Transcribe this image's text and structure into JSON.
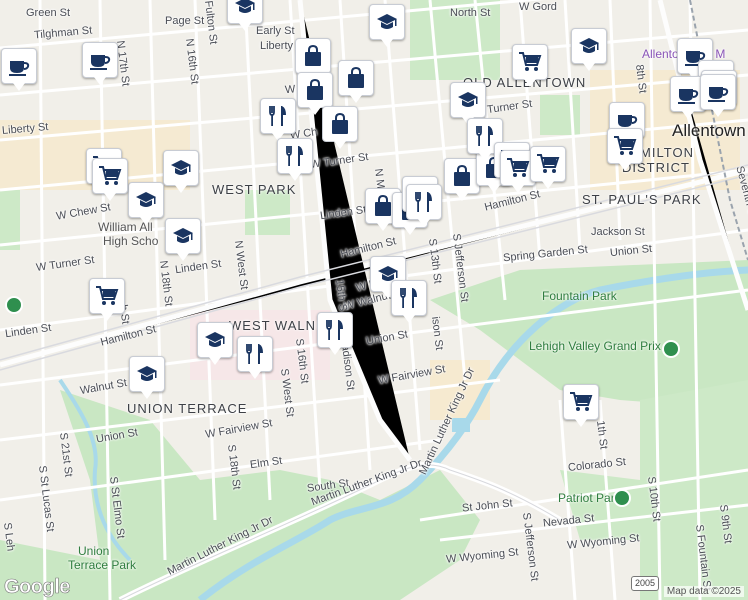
{
  "map": {
    "city": "Allentown",
    "districts": [
      "OLD ALLENTOWN",
      "WEST PARK",
      "ST. PAUL'S PARK",
      "WEST WALNUT",
      "UNION TERRACE",
      "HAMILTON DISTRICT"
    ],
    "district_hamilton_top": "HAMILTON",
    "district_hamilton_bottom": "DISTRICT",
    "pois": {
      "lehigh_valley_grand_prix": "Lehigh Valley Grand Prix",
      "fountain_park": "Fountain Park",
      "patriot_park": "Patriot Park",
      "union_terrace_park_1": "Union",
      "union_terrace_park_2": "Terrace Park",
      "william_allen_1": "William All",
      "william_allen_2": "High Scho",
      "allentown_art_museum": "Allentown Art M"
    },
    "streets": {
      "green": "Green St",
      "tilghman": "Tilghman St",
      "n17th": "N 17th St",
      "page": "Page St",
      "n16th": "N 16th St",
      "fulton_top": "Fulton St",
      "early": "Early St",
      "liberty_top": "Liberty St",
      "liberty_left": "Liberty St",
      "w_gordon": "W Go",
      "north": "North St",
      "w_gordon_right": "W Gord",
      "w_turner_mid": "W Turner St",
      "w_turner_left": "W Turner St",
      "turner_right": "Turner St",
      "w_chew": "W Chew St",
      "w_ch": "W Ch",
      "linden_mid": "Linden St",
      "linden_left": "Linden St",
      "linden_far": "Linden St",
      "n18th": "N 18th St",
      "n_west": "N West St",
      "n_m": "N M",
      "hamilton_main": "Hamilton St",
      "hamilton_left": "Hamilton St",
      "hamilton_right": "Hamilton St",
      "w_ma": "W Ma",
      "walnut_w": "W Walnut",
      "walnut_left": "Walnut St",
      "s13th": "S 13th St",
      "s_jefferson": "S Jefferson St",
      "jackson": "Jackson St",
      "spring_garden": "Spring Garden St",
      "union_right": "Union St",
      "union_mid": "Union St",
      "union_left": "Union St",
      "th15": "15th S",
      "h18th": "h St",
      "s16th": "S 16th St",
      "s_west": "S West St",
      "madison": "adison St",
      "ison": "ison St",
      "w_fairview_mid": "W Fairview St",
      "w_fairview_left": "W Fairview St",
      "s21st": "S 21st St",
      "s_st_lucas": "S St Lucas St",
      "s18th": "S 18th St",
      "elm": "Elm St",
      "south": "South St",
      "mlk_mid": "Martin Luther King Jr Dr",
      "mlk_left": "Martin Luther King Jr Dr",
      "mlk_right": "Martin Luther King Jr Dr",
      "s_st_elmo": "S St Elmo St",
      "s_leh": "S Leh",
      "st_john": "St John St",
      "s_jefferson_low": "S Jefferson St",
      "nevada": "Nevada St",
      "colorado": "Colorado St",
      "s10th": "S 10th St",
      "s11th": "1th St",
      "s9th": "S 9th St",
      "s_fountain": "S Fountain St",
      "w_wyoming_mid": "W Wyoming St",
      "w_wyoming_right": "W Wyoming St",
      "th8": "8th St",
      "seventh": "Seventh St",
      "union_far_right": "Union St"
    },
    "route_shield": "2005",
    "attribution": "Map data ©2025",
    "logo": "Google"
  },
  "markers": [
    {
      "icon": "school-icon"
    },
    {
      "icon": "school-icon"
    },
    {
      "icon": "school-icon"
    },
    {
      "icon": "school-icon"
    },
    {
      "icon": "school-icon"
    },
    {
      "icon": "school-icon"
    },
    {
      "icon": "school-icon"
    },
    {
      "icon": "school-icon"
    },
    {
      "icon": "school-icon"
    },
    {
      "icon": "school-icon"
    },
    {
      "icon": "cafe-icon"
    },
    {
      "icon": "cafe-icon"
    },
    {
      "icon": "cafe-icon"
    },
    {
      "icon": "cafe-icon"
    },
    {
      "icon": "cafe-icon"
    },
    {
      "icon": "cafe-icon"
    },
    {
      "icon": "cafe-icon"
    },
    {
      "icon": "cafe-icon"
    },
    {
      "icon": "shopping-bag-icon"
    },
    {
      "icon": "shopping-bag-icon"
    },
    {
      "icon": "shopping-bag-icon"
    },
    {
      "icon": "shopping-bag-icon"
    },
    {
      "icon": "shopping-bag-icon"
    },
    {
      "icon": "shopping-bag-icon"
    },
    {
      "icon": "shopping-bag-icon"
    },
    {
      "icon": "shopping-bag-icon"
    },
    {
      "icon": "restaurant-icon"
    },
    {
      "icon": "restaurant-icon"
    },
    {
      "icon": "restaurant-icon"
    },
    {
      "icon": "restaurant-icon"
    },
    {
      "icon": "restaurant-icon"
    },
    {
      "icon": "restaurant-icon"
    },
    {
      "icon": "restaurant-icon"
    },
    {
      "icon": "restaurant-icon"
    },
    {
      "icon": "grocery-cart-icon"
    },
    {
      "icon": "grocery-cart-icon"
    },
    {
      "icon": "grocery-cart-icon"
    },
    {
      "icon": "grocery-cart-icon"
    },
    {
      "icon": "grocery-cart-icon"
    },
    {
      "icon": "grocery-cart-icon"
    },
    {
      "icon": "grocery-cart-icon"
    },
    {
      "icon": "grocery-cart-icon"
    },
    {
      "icon": "grocery-cart-icon"
    }
  ],
  "colors": {
    "background": "#f1efe9",
    "park": "#c9e7c3",
    "water": "#a8d9ea",
    "marker_fill": "#1a3561",
    "road": "#ffffff",
    "highlight_area": "#f6ead0"
  }
}
